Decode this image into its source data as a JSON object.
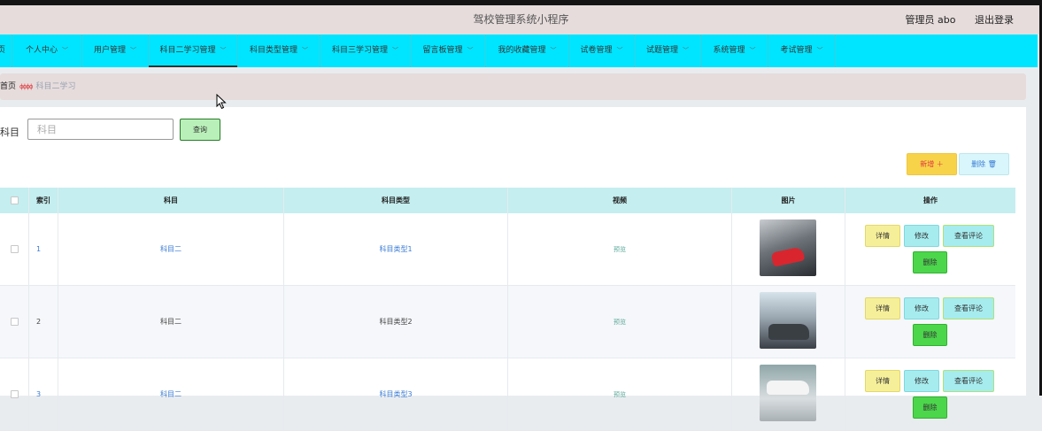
{
  "header": {
    "title": "驾校管理系统小程序",
    "user_label": "管理员 abo",
    "logout": "退出登录"
  },
  "nav": {
    "items": [
      {
        "label": "页"
      },
      {
        "label": "个人中心"
      },
      {
        "label": "用户管理"
      },
      {
        "label": "科目二学习管理"
      },
      {
        "label": "科目类型管理"
      },
      {
        "label": "科目三学习管理"
      },
      {
        "label": "留言板管理"
      },
      {
        "label": "我的收藏管理"
      },
      {
        "label": "试卷管理"
      },
      {
        "label": "试题管理"
      },
      {
        "label": "系统管理"
      },
      {
        "label": "考试管理"
      }
    ],
    "active_index": 3
  },
  "breadcrumb": {
    "home": "首页",
    "separator": "ɸɸɸɸ",
    "current": "科目二学习"
  },
  "search": {
    "label": "科目",
    "placeholder": "科目",
    "value": "",
    "button": "查询"
  },
  "actions": {
    "add": "新增 ＋",
    "delete": "删除 🗑"
  },
  "table": {
    "headers": [
      "",
      "索引",
      "科目",
      "科目类型",
      "视频",
      "图片",
      "操作"
    ],
    "rows": [
      {
        "index": "1",
        "subject": "科目二",
        "type": "科目类型1",
        "video": "预览"
      },
      {
        "index": "2",
        "subject": "科目二",
        "type": "科目类型2",
        "video": "预览"
      },
      {
        "index": "3",
        "subject": "科目二",
        "type": "科目类型3",
        "video": "预览"
      }
    ],
    "ops": {
      "detail": "详情",
      "edit": "修改",
      "comment": "查看评论",
      "delete": "删除"
    }
  },
  "colors": {
    "nav_bg": "#00e5ff",
    "header_bg": "#e6dcdc",
    "table_header_bg": "#c5eef0",
    "add_button": "#f7d34a",
    "delete_button": "#4cd64c"
  }
}
